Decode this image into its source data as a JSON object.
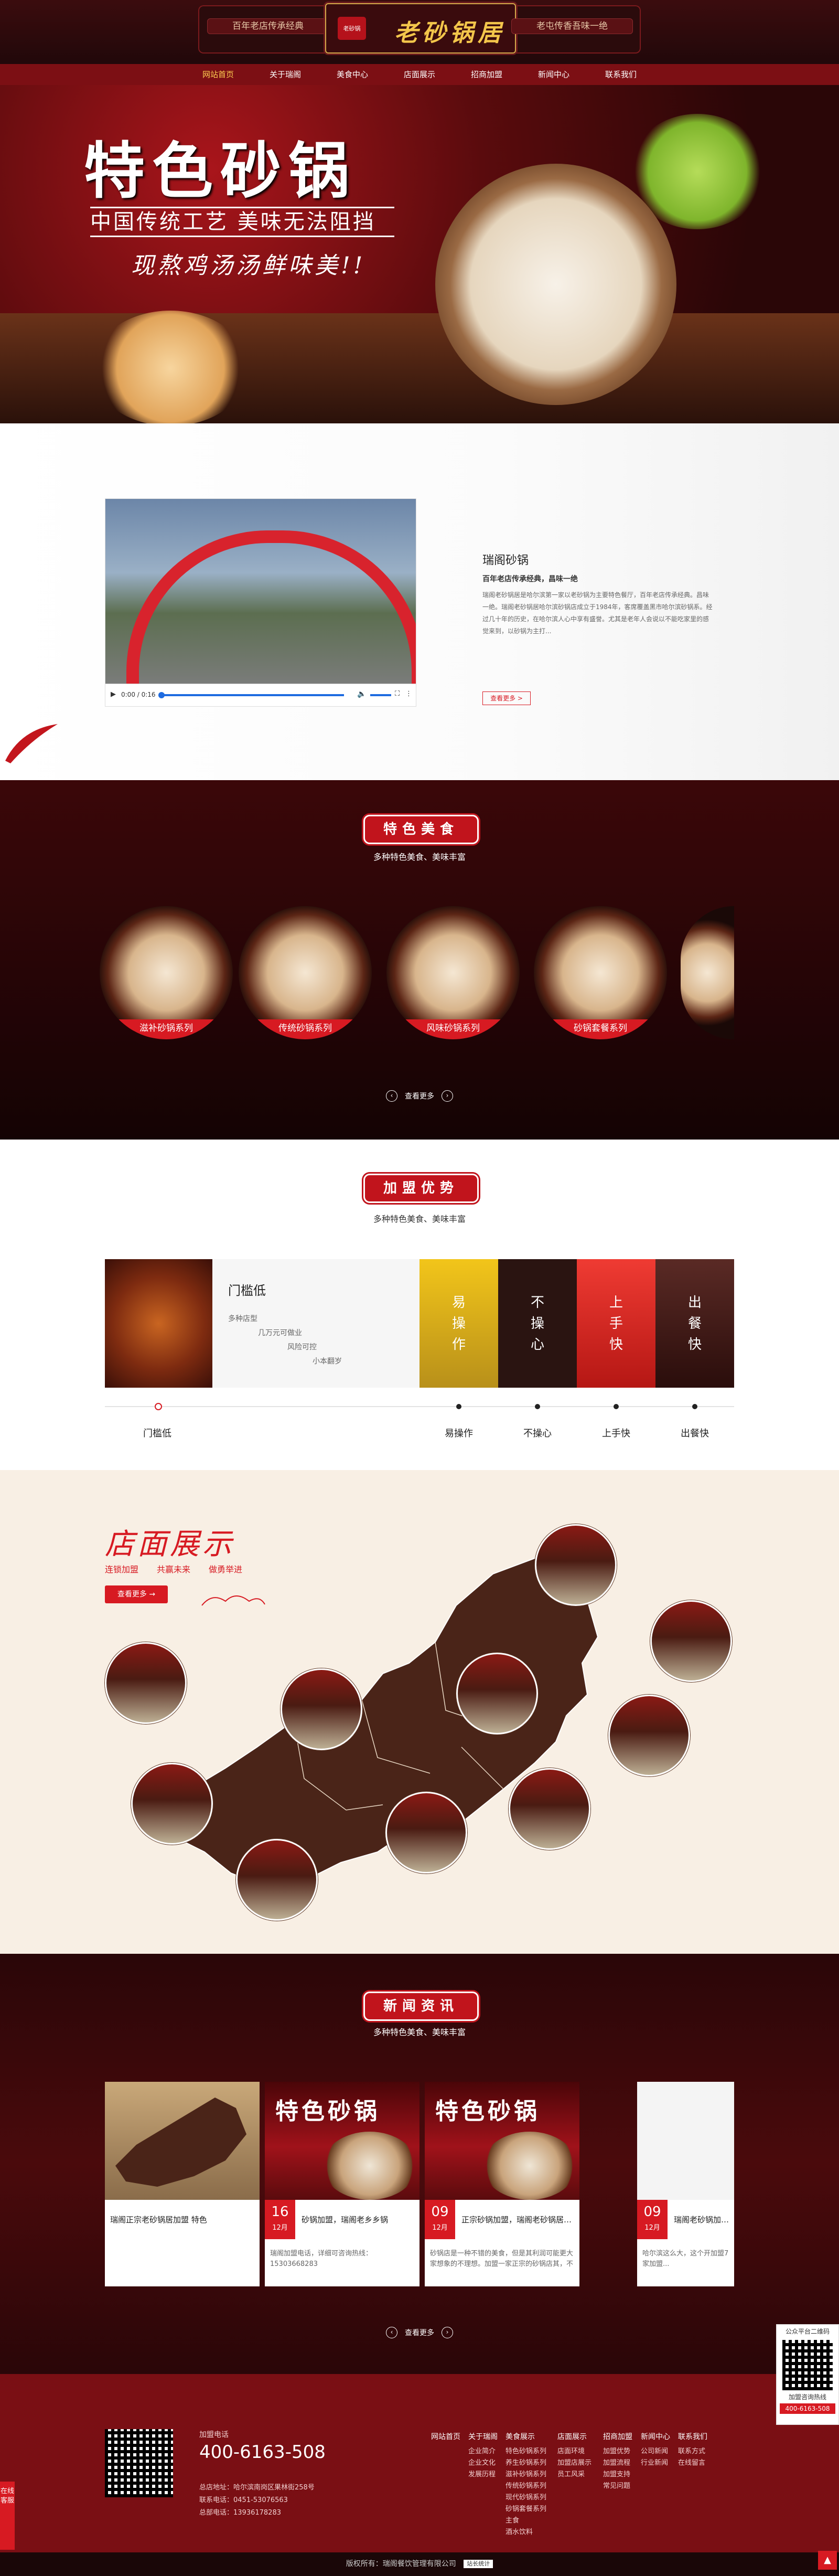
{
  "header": {
    "slogan_left": "百年老店传承经典",
    "logo_text": "老砂锅居",
    "logo_seal": "老砂锅",
    "slogan_right": "老屯传香吾味一绝"
  },
  "nav": {
    "items": [
      {
        "label": "网站首页",
        "active": true
      },
      {
        "label": "关于瑞阁"
      },
      {
        "label": "美食中心"
      },
      {
        "label": "店面展示"
      },
      {
        "label": "招商加盟"
      },
      {
        "label": "新闻中心"
      },
      {
        "label": "联系我们"
      }
    ]
  },
  "hero": {
    "title": "特色砂锅",
    "subtitle": "中国传统工艺 美味无法阻挡",
    "tagline": "现熬鸡汤汤鲜味美!!"
  },
  "about": {
    "video_time": "0:00 / 0:16",
    "title": "瑞阁砂锅",
    "bold_line": "百年老店传承经典，昌味一绝",
    "text": "瑞阁老砂锅居是哈尔滨第一家以老砂锅为主要特色餐厅，百年老店传承经典。昌味一绝。瑞阁老砂锅居哈尔滨砂锅店成立于1984年，客席覆盖黑市哈尔滨砂锅系。经过几十年的历史，在哈尔滨人心中享有盛誉。尤其是老年人会说以不能吃家里的感觉来到，以砂锅为主打...",
    "more": "查看更多 >"
  },
  "food": {
    "heading": "特色美食",
    "subheading": "多种特色美食、美味丰富",
    "items": [
      "滋补砂锅系列",
      "传统砂锅系列",
      "风味砂锅系列",
      "砂锅套餐系列"
    ],
    "pager_label": "查看更多"
  },
  "franchise": {
    "heading": "加盟优势",
    "subheading": "多种特色美食、美味丰富",
    "card_title": "门槛低",
    "lines": [
      "多种店型",
      "几万元可做业",
      "风险可控",
      "小本翻岁"
    ],
    "tiles": [
      "易操作",
      "不操心",
      "上手快",
      "出餐快"
    ],
    "tab_labels": [
      "门槛低",
      "易操作",
      "不操心",
      "上手快",
      "出餐快"
    ]
  },
  "stores": {
    "title": "店面展示",
    "tags": [
      "连锁加盟",
      "共赢未来",
      "做勇举进"
    ],
    "button": "查看更多 →"
  },
  "news": {
    "heading": "新闻资讯",
    "subheading": "多种特色美食、美味丰富",
    "poster_title": "特色砂锅",
    "items": [
      {
        "day": "",
        "month": "",
        "title": "瑞阁正宗老砂锅居加盟 特色",
        "text": ""
      },
      {
        "day": "16",
        "month": "12月",
        "title": "砂锅加盟，瑞阁老乡乡锅",
        "text": "瑞阁加盟电话，详细可咨询热线：15303668283"
      },
      {
        "day": "09",
        "month": "12月",
        "title": "正宗砂锅加盟，瑞阁老砂锅居招商创业",
        "text": "砂锅店是一种不错的美食，但是其利润可能更大家想象的不理想。加盟一家正宗的砂锅店其，不需要经验啊..."
      },
      {
        "day": "09",
        "month": "12月",
        "title": "瑞阁老砂锅加盟，瑞",
        "text": "哈尔滨这么大，这个开加盟7家加盟..."
      }
    ],
    "pager_label": "查看更多"
  },
  "footer": {
    "hotline_label": "加盟电话",
    "hotline": "400-6163-508",
    "info": [
      "总店地址：哈尔滨南岗区果林街258号",
      "联系电话：0451-53076563",
      "总部电话：13936178283"
    ],
    "columns": [
      {
        "head": "网站首页",
        "links": []
      },
      {
        "head": "关于瑞阁",
        "links": [
          "企业简介",
          "企业文化",
          "发展历程"
        ]
      },
      {
        "head": "美食展示",
        "links": [
          "特色砂锅系列",
          "养生砂锅系列",
          "滋补砂锅系列",
          "传统砂锅系列",
          "现代砂锅系列",
          "砂锅套餐系列",
          "主食",
          "酒水饮料"
        ]
      },
      {
        "head": "店面展示",
        "links": [
          "店面环境",
          "加盟店展示",
          "员工风采"
        ]
      },
      {
        "head": "招商加盟",
        "links": [
          "加盟优势",
          "加盟流程",
          "加盟支持",
          "常见问题"
        ]
      },
      {
        "head": "新闻中心",
        "links": [
          "公司新闻",
          "行业新闻"
        ]
      },
      {
        "head": "联系我们",
        "links": [
          "联系方式",
          "在线留言"
        ]
      }
    ],
    "copyright": "版权所有：瑞阁餐饮管理有限公司",
    "cnzz": "站长统计"
  },
  "float": {
    "qr_title": "公众平台二维码",
    "hint": "加盟咨询热线",
    "phone": "400-6163-508",
    "service": "在线客服",
    "top": "▲"
  },
  "colors": {
    "brand_red": "#d71a22",
    "dark_red": "#7c0f14",
    "gold": "#f3c64b"
  }
}
